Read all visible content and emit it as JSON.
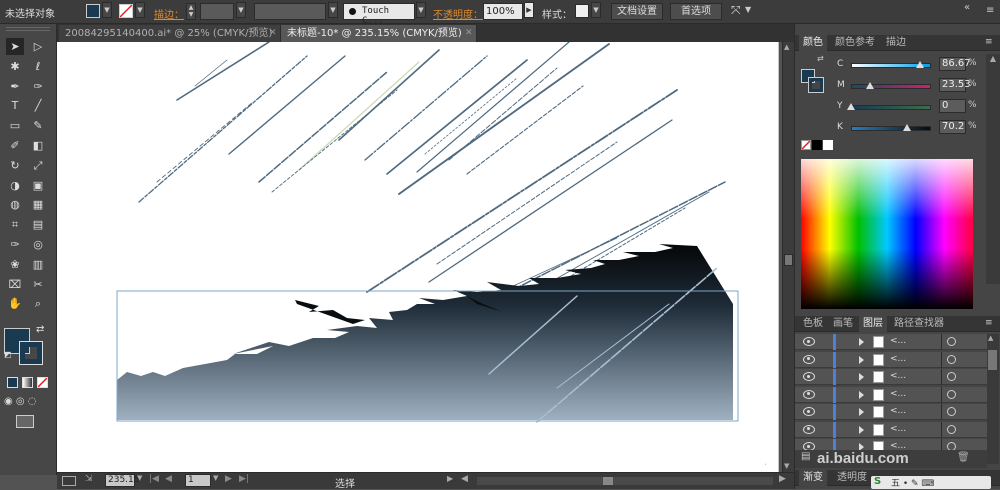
{
  "control_bar": {
    "selection_status": "未选择对象",
    "stroke_label": "描边：",
    "brush_name": "Touch C...",
    "opacity_label": "不透明度：",
    "opacity_value": "100%",
    "style_label": "样式：",
    "doc_setup_button": "文档设置",
    "preferences_button": "首选项",
    "fill_color": "#1a3a52"
  },
  "tabs": [
    {
      "label": "20084295140400.ai* @ 25% (CMYK/预览)",
      "active": false
    },
    {
      "label": "未标题-10* @ 235.15% (CMYK/预览)",
      "active": true
    }
  ],
  "tools": [
    "selection-tool",
    "direct-selection-tool",
    "magic-wand-tool",
    "lasso-tool",
    "pen-tool",
    "curvature-tool",
    "type-tool",
    "line-tool",
    "rectangle-tool",
    "paintbrush-tool",
    "pencil-tool",
    "eraser-tool",
    "rotate-tool",
    "scale-tool",
    "width-tool",
    "free-transform-tool",
    "shape-builder-tool",
    "perspective-grid-tool",
    "mesh-tool",
    "gradient-tool",
    "eyedropper-tool",
    "blend-tool",
    "symbol-sprayer-tool",
    "column-graph-tool",
    "artboard-tool",
    "slice-tool",
    "hand-tool",
    "zoom-tool"
  ],
  "status_bar": {
    "zoom": "235.15",
    "page": "1",
    "tool_label": "选择"
  },
  "color_panel": {
    "tabs": [
      "颜色",
      "颜色参考",
      "描边"
    ],
    "sliders": [
      {
        "label": "C",
        "value": "86.67",
        "fill": 0.8667,
        "bar": "linear-gradient(to right,#fff,#00a0e9)"
      },
      {
        "label": "M",
        "value": "23.53",
        "fill": 0.2353,
        "bar": "linear-gradient(to right,#144c64,#d41d6e)"
      },
      {
        "label": "Y",
        "value": "0",
        "fill": 0,
        "bar": "linear-gradient(to right,#183a52,#3c6e4a)"
      },
      {
        "label": "K",
        "value": "70.2",
        "fill": 0.702,
        "bar": "linear-gradient(to right,#2a7fc0,#0a0a0a)"
      }
    ],
    "percent_sign": "%",
    "current_color": "#1a3a52"
  },
  "layers_panel": {
    "tabs": [
      "色板",
      "画笔",
      "图层",
      "路径查找器"
    ],
    "active_tab": "图层",
    "rows": [
      "<...",
      "<...",
      "<...",
      "<...",
      "<...",
      "<...",
      "<..."
    ]
  },
  "bottom_panel": {
    "tabs": [
      "渐变",
      "透明度"
    ]
  },
  "watermark": "ai.baidu.com"
}
